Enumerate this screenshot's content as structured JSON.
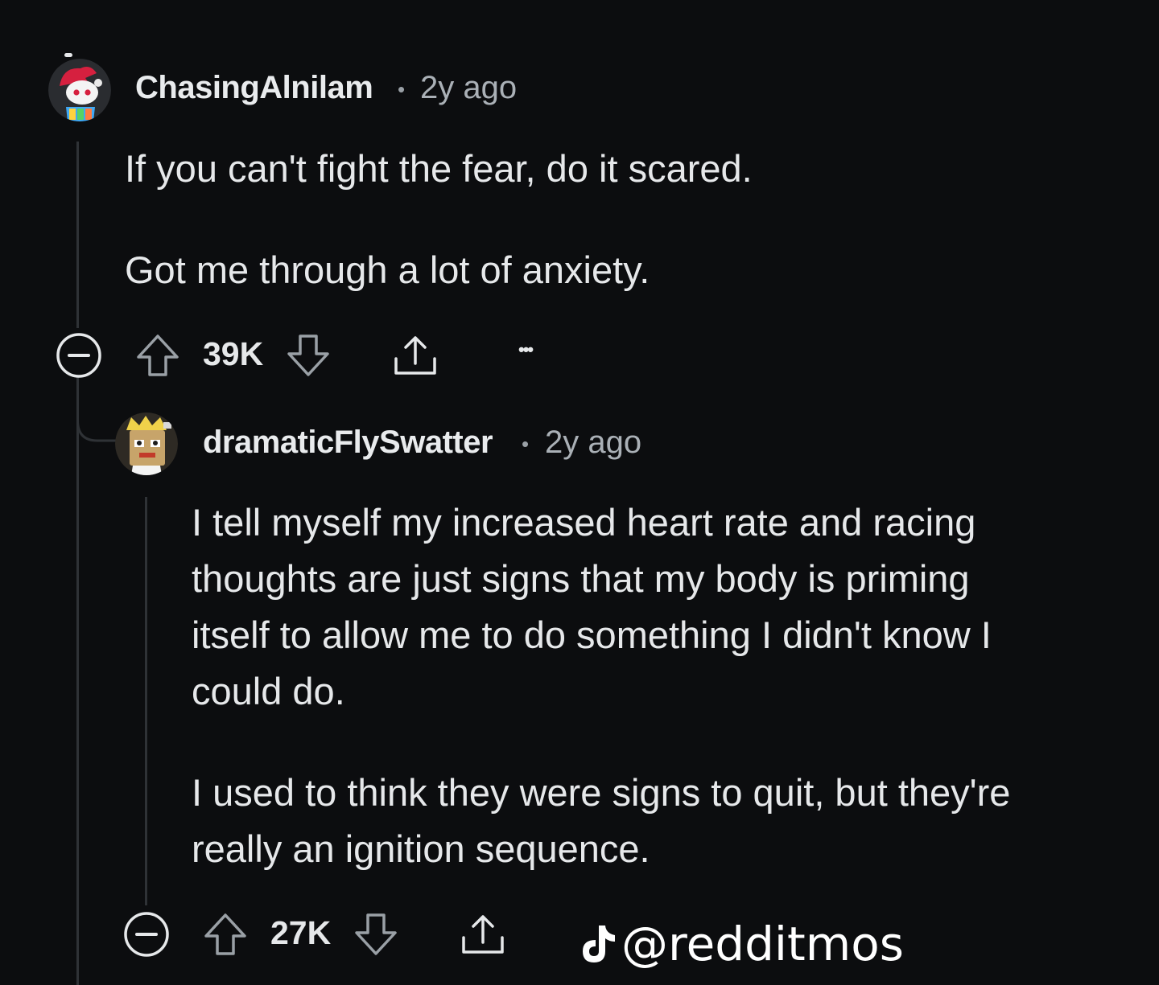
{
  "comments": [
    {
      "username": "ChasingAlnilam",
      "separator": "•",
      "time": "2y ago",
      "paragraphs": [
        [
          "If you can't fight the fear, do it scared."
        ],
        [
          "Got me through a lot of anxiety."
        ]
      ],
      "score": "39K",
      "avatar_icon": "snoo-avatar-red-hair"
    },
    {
      "username": "dramaticFlySwatter",
      "separator": "•",
      "time": "2y ago",
      "paragraphs": [
        [
          "I tell myself my increased heart rate and racing",
          "thoughts are just signs that my body is priming",
          "itself to allow me to do something I didn't know I",
          "could do."
        ],
        [
          "I used to think they were signs to quit, but they're",
          "really an ignition sequence."
        ]
      ],
      "score": "27K",
      "avatar_icon": "snoo-avatar-box-head"
    }
  ],
  "more_options_label": "•••",
  "watermark": {
    "text": "@redditmos",
    "icon": "tiktok-icon"
  },
  "colors": {
    "background": "#0c0d0f",
    "text": "#e6e8ea",
    "muted": "#aab0b6",
    "thread_line": "#2f3236"
  }
}
